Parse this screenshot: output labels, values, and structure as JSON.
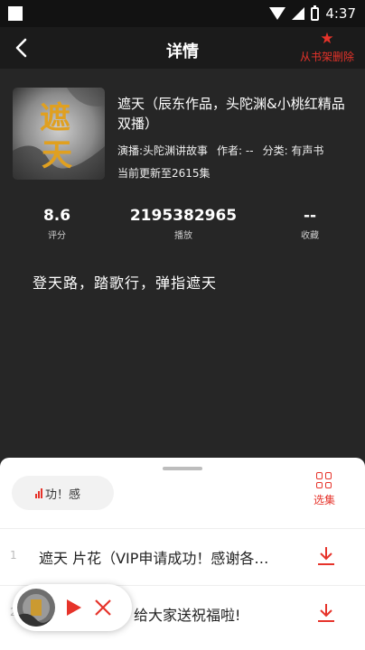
{
  "status": {
    "time": "4:37"
  },
  "header": {
    "title": "详情",
    "remove_label": "从书架删除"
  },
  "book": {
    "cover_char_top": "遮",
    "cover_char_bottom": "天",
    "title": "遮天（辰东作品，头陀渊&小桃红精品双播）",
    "narrator": "演播:头陀渊讲故事",
    "author": "作者: --",
    "category": "分类: 有声书",
    "update_info": "当前更新至2615集"
  },
  "stats": [
    {
      "value": "8.6",
      "label": "评分"
    },
    {
      "value": "2195382965",
      "label": "播放"
    },
    {
      "value": "--",
      "label": "收藏"
    }
  ],
  "description": "登天路，踏歌行，弹指遮天",
  "playlist": {
    "now_playing": "功！感",
    "select_label": "选集",
    "episodes": [
      {
        "num": "1",
        "title": "遮天 片花（VIP申请成功！感谢各…"
      },
      {
        "num": "2",
        "title": "给大家送祝福啦!"
      }
    ]
  },
  "colors": {
    "accent": "#e6332a",
    "background": "#262626",
    "sheet": "#ffffff"
  },
  "icons": [
    "back-arrow-icon",
    "star-icon",
    "bars-icon",
    "grid-icon",
    "download-icon",
    "play-icon",
    "close-icon"
  ]
}
